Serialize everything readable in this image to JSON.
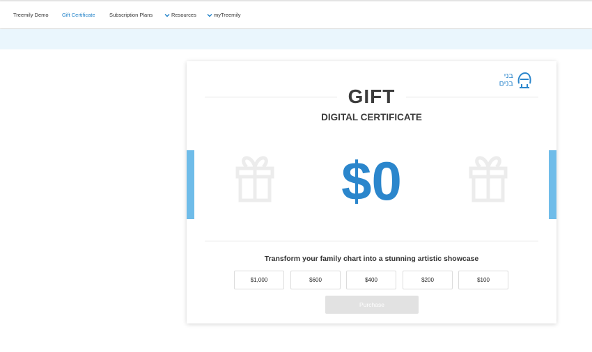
{
  "nav": {
    "items": [
      {
        "label": "Treemily Demo",
        "active": false,
        "dropdown": false
      },
      {
        "label": "Gift Certificate",
        "active": true,
        "dropdown": false
      },
      {
        "label": "Subscription Plans",
        "active": false,
        "dropdown": false
      },
      {
        "label": "Resources",
        "active": false,
        "dropdown": true
      },
      {
        "label": "myTreemily",
        "active": false,
        "dropdown": true
      }
    ],
    "accent_color": "#1e80c8"
  },
  "certificate": {
    "logo_text_line1": "בני",
    "logo_text_line2": "בנים",
    "title": "GIFT",
    "subtitle": "DIGITAL CERTIFICATE",
    "amount": "$0",
    "tagline": "Transform your family chart into a stunning artistic showcase",
    "amount_options": [
      "$1,000",
      "$600",
      "$400",
      "$200",
      "$100"
    ],
    "purchase_label": "Purchase",
    "icons": [
      "gift-icon",
      "gift-icon"
    ],
    "amount_color": "#2b86cc",
    "side_bar_color": "#6fbce9"
  }
}
